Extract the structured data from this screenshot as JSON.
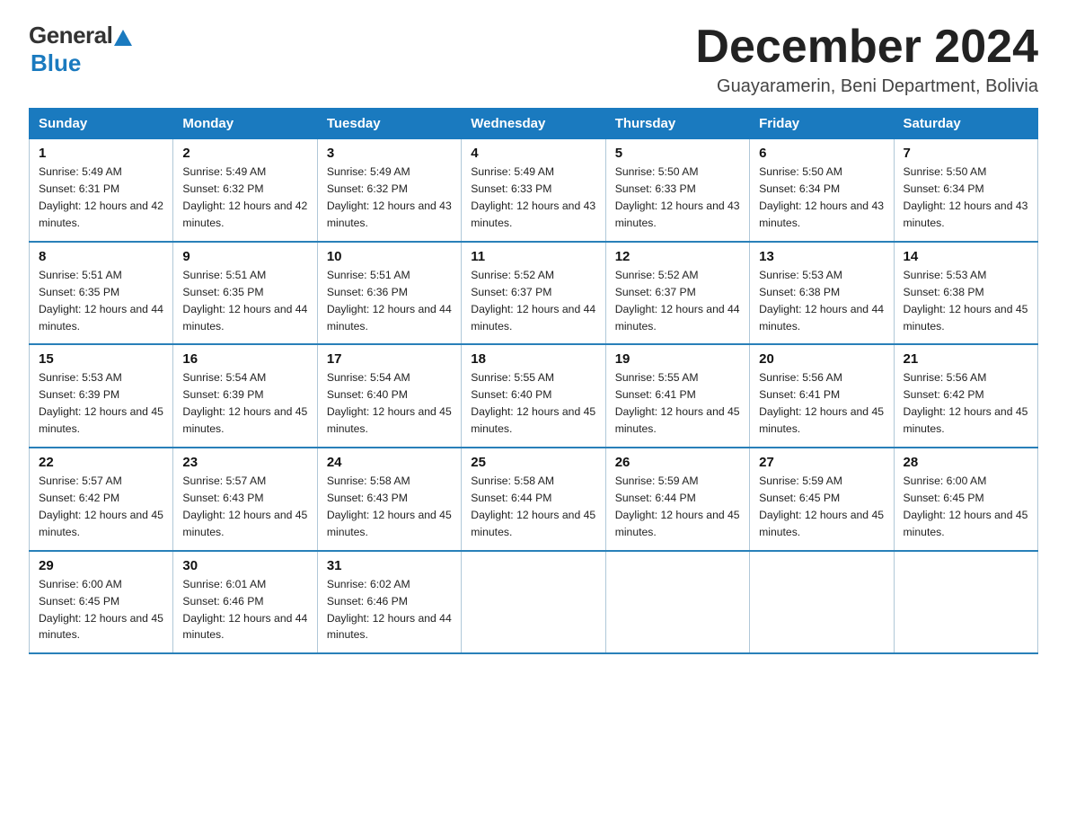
{
  "logo": {
    "general": "General",
    "blue": "Blue"
  },
  "title": {
    "month_year": "December 2024",
    "location": "Guayaramerin, Beni Department, Bolivia"
  },
  "days_of_week": [
    "Sunday",
    "Monday",
    "Tuesday",
    "Wednesday",
    "Thursday",
    "Friday",
    "Saturday"
  ],
  "weeks": [
    [
      {
        "day": "1",
        "sunrise": "5:49 AM",
        "sunset": "6:31 PM",
        "daylight": "12 hours and 42 minutes."
      },
      {
        "day": "2",
        "sunrise": "5:49 AM",
        "sunset": "6:32 PM",
        "daylight": "12 hours and 42 minutes."
      },
      {
        "day": "3",
        "sunrise": "5:49 AM",
        "sunset": "6:32 PM",
        "daylight": "12 hours and 43 minutes."
      },
      {
        "day": "4",
        "sunrise": "5:49 AM",
        "sunset": "6:33 PM",
        "daylight": "12 hours and 43 minutes."
      },
      {
        "day": "5",
        "sunrise": "5:50 AM",
        "sunset": "6:33 PM",
        "daylight": "12 hours and 43 minutes."
      },
      {
        "day": "6",
        "sunrise": "5:50 AM",
        "sunset": "6:34 PM",
        "daylight": "12 hours and 43 minutes."
      },
      {
        "day": "7",
        "sunrise": "5:50 AM",
        "sunset": "6:34 PM",
        "daylight": "12 hours and 43 minutes."
      }
    ],
    [
      {
        "day": "8",
        "sunrise": "5:51 AM",
        "sunset": "6:35 PM",
        "daylight": "12 hours and 44 minutes."
      },
      {
        "day": "9",
        "sunrise": "5:51 AM",
        "sunset": "6:35 PM",
        "daylight": "12 hours and 44 minutes."
      },
      {
        "day": "10",
        "sunrise": "5:51 AM",
        "sunset": "6:36 PM",
        "daylight": "12 hours and 44 minutes."
      },
      {
        "day": "11",
        "sunrise": "5:52 AM",
        "sunset": "6:37 PM",
        "daylight": "12 hours and 44 minutes."
      },
      {
        "day": "12",
        "sunrise": "5:52 AM",
        "sunset": "6:37 PM",
        "daylight": "12 hours and 44 minutes."
      },
      {
        "day": "13",
        "sunrise": "5:53 AM",
        "sunset": "6:38 PM",
        "daylight": "12 hours and 44 minutes."
      },
      {
        "day": "14",
        "sunrise": "5:53 AM",
        "sunset": "6:38 PM",
        "daylight": "12 hours and 45 minutes."
      }
    ],
    [
      {
        "day": "15",
        "sunrise": "5:53 AM",
        "sunset": "6:39 PM",
        "daylight": "12 hours and 45 minutes."
      },
      {
        "day": "16",
        "sunrise": "5:54 AM",
        "sunset": "6:39 PM",
        "daylight": "12 hours and 45 minutes."
      },
      {
        "day": "17",
        "sunrise": "5:54 AM",
        "sunset": "6:40 PM",
        "daylight": "12 hours and 45 minutes."
      },
      {
        "day": "18",
        "sunrise": "5:55 AM",
        "sunset": "6:40 PM",
        "daylight": "12 hours and 45 minutes."
      },
      {
        "day": "19",
        "sunrise": "5:55 AM",
        "sunset": "6:41 PM",
        "daylight": "12 hours and 45 minutes."
      },
      {
        "day": "20",
        "sunrise": "5:56 AM",
        "sunset": "6:41 PM",
        "daylight": "12 hours and 45 minutes."
      },
      {
        "day": "21",
        "sunrise": "5:56 AM",
        "sunset": "6:42 PM",
        "daylight": "12 hours and 45 minutes."
      }
    ],
    [
      {
        "day": "22",
        "sunrise": "5:57 AM",
        "sunset": "6:42 PM",
        "daylight": "12 hours and 45 minutes."
      },
      {
        "day": "23",
        "sunrise": "5:57 AM",
        "sunset": "6:43 PM",
        "daylight": "12 hours and 45 minutes."
      },
      {
        "day": "24",
        "sunrise": "5:58 AM",
        "sunset": "6:43 PM",
        "daylight": "12 hours and 45 minutes."
      },
      {
        "day": "25",
        "sunrise": "5:58 AM",
        "sunset": "6:44 PM",
        "daylight": "12 hours and 45 minutes."
      },
      {
        "day": "26",
        "sunrise": "5:59 AM",
        "sunset": "6:44 PM",
        "daylight": "12 hours and 45 minutes."
      },
      {
        "day": "27",
        "sunrise": "5:59 AM",
        "sunset": "6:45 PM",
        "daylight": "12 hours and 45 minutes."
      },
      {
        "day": "28",
        "sunrise": "6:00 AM",
        "sunset": "6:45 PM",
        "daylight": "12 hours and 45 minutes."
      }
    ],
    [
      {
        "day": "29",
        "sunrise": "6:00 AM",
        "sunset": "6:45 PM",
        "daylight": "12 hours and 45 minutes."
      },
      {
        "day": "30",
        "sunrise": "6:01 AM",
        "sunset": "6:46 PM",
        "daylight": "12 hours and 44 minutes."
      },
      {
        "day": "31",
        "sunrise": "6:02 AM",
        "sunset": "6:46 PM",
        "daylight": "12 hours and 44 minutes."
      },
      null,
      null,
      null,
      null
    ]
  ]
}
